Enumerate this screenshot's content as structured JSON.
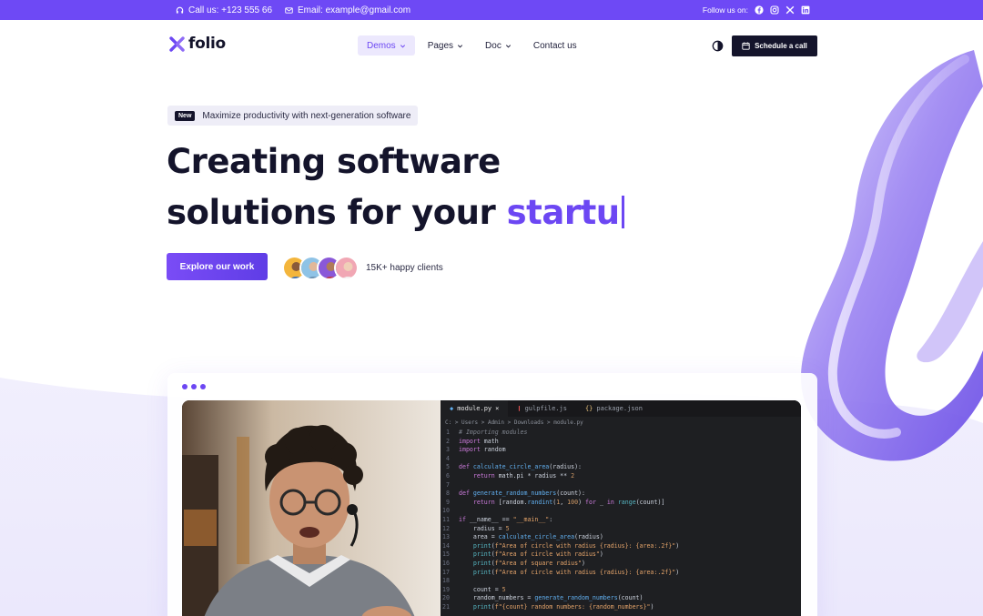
{
  "topbar": {
    "call_label": "Call us: +123 555 66",
    "email_label": "Email: example@gmail.com",
    "follow_label": "Follow us on:",
    "socials": [
      "facebook-icon",
      "instagram-icon",
      "x-icon",
      "linkedin-icon"
    ]
  },
  "header": {
    "logo_text": "folio",
    "nav": [
      {
        "label": "Demos",
        "active": true,
        "dropdown": true
      },
      {
        "label": "Pages",
        "active": false,
        "dropdown": true
      },
      {
        "label": "Doc",
        "active": false,
        "dropdown": true
      },
      {
        "label": "Contact us",
        "active": false,
        "dropdown": false
      }
    ],
    "cta_label": "Schedule a call"
  },
  "hero": {
    "badge_tag": "New",
    "badge_text": "Maximize productivity with next-generation software",
    "title_line1": "Creating software",
    "title_line2": "solutions for your ",
    "title_accent": "startu",
    "explore_label": "Explore our work",
    "clients_label": "15K+ happy clients"
  },
  "editor": {
    "tabs": [
      {
        "label": "module.py",
        "active": true,
        "close": "×"
      },
      {
        "label": "gulpfile.js",
        "active": false
      },
      {
        "label": "package.json",
        "active": false
      }
    ],
    "breadcrumb": "C: > Users > Admin > Downloads > module.py",
    "lines": [
      "# Importing modules",
      "import math",
      "import random",
      "",
      "def calculate_circle_area(radius):",
      "    return math.pi * radius ** 2",
      "",
      "def generate_random_numbers(count):",
      "    return [random.randint(1, 100) for _ in range(count)]",
      "",
      "if __name__ == \"__main__\":",
      "    radius = 5",
      "    area = calculate_circle_area(radius)",
      "    print(f\"Area of circle with radius {radius}: {area:.2f}\")",
      "    print(f\"Area of circle with radius\")",
      "    print(f\"Area of square radius\")",
      "    print(f\"Area of circle with radius {radius}: {area:.2f}\")",
      "",
      "    count = 5",
      "    random_numbers = generate_random_numbers(count)",
      "    print(f\"{count} random numbers: {random_numbers}\")"
    ]
  },
  "colors": {
    "brand": "#6c47f3",
    "dark": "#14142b",
    "topbar": "#6e49f5"
  }
}
